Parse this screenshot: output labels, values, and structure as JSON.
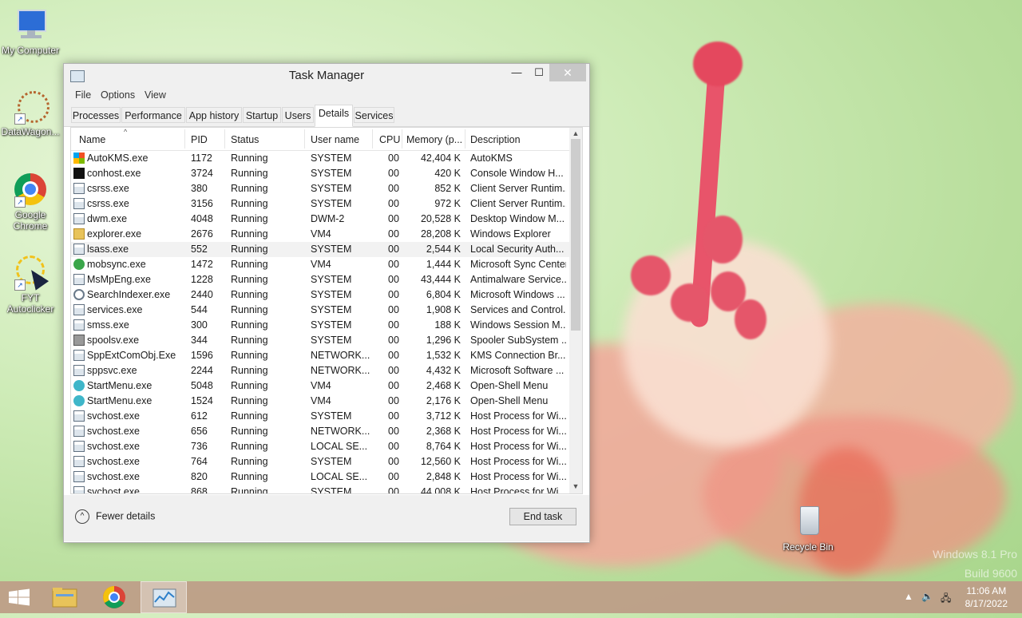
{
  "desktop": {
    "icons": [
      {
        "label": "My Computer"
      },
      {
        "label": "DataWagon..."
      },
      {
        "label": "Google Chrome"
      },
      {
        "label": "FYT Autoclicker"
      },
      {
        "label": "Recycle Bin"
      }
    ],
    "watermark_line1": "Windows 8.1 Pro",
    "watermark_line2": "Build 9600"
  },
  "window": {
    "title": "Task Manager",
    "minimize": "—",
    "maximize": "☐",
    "close": "✕",
    "menu": [
      "File",
      "Options",
      "View"
    ],
    "tabs": [
      "Processes",
      "Performance",
      "App history",
      "Startup",
      "Users",
      "Details",
      "Services"
    ],
    "active_tab": "Details",
    "columns": [
      "Name",
      "PID",
      "Status",
      "User name",
      "CPU",
      "Memory (p...",
      "Description"
    ],
    "rows": [
      {
        "name": "AutoKMS.exe",
        "pid": "1172",
        "status": "Running",
        "user": "SYSTEM",
        "cpu": "00",
        "mem": "42,404 K",
        "desc": "AutoKMS",
        "icon": "ms-logo-icon"
      },
      {
        "name": "conhost.exe",
        "pid": "3724",
        "status": "Running",
        "user": "SYSTEM",
        "cpu": "00",
        "mem": "420 K",
        "desc": "Console Window H...",
        "icon": "console-icon"
      },
      {
        "name": "csrss.exe",
        "pid": "380",
        "status": "Running",
        "user": "SYSTEM",
        "cpu": "00",
        "mem": "852 K",
        "desc": "Client Server Runtim...",
        "icon": "app-icon"
      },
      {
        "name": "csrss.exe",
        "pid": "3156",
        "status": "Running",
        "user": "SYSTEM",
        "cpu": "00",
        "mem": "972 K",
        "desc": "Client Server Runtim...",
        "icon": "app-icon"
      },
      {
        "name": "dwm.exe",
        "pid": "4048",
        "status": "Running",
        "user": "DWM-2",
        "cpu": "00",
        "mem": "20,528 K",
        "desc": "Desktop Window M...",
        "icon": "app-icon"
      },
      {
        "name": "explorer.exe",
        "pid": "2676",
        "status": "Running",
        "user": "VM4",
        "cpu": "00",
        "mem": "28,208 K",
        "desc": "Windows Explorer",
        "icon": "folder-icon"
      },
      {
        "name": "lsass.exe",
        "pid": "552",
        "status": "Running",
        "user": "SYSTEM",
        "cpu": "00",
        "mem": "2,544 K",
        "desc": "Local Security Auth...",
        "icon": "app-icon"
      },
      {
        "name": "mobsync.exe",
        "pid": "1472",
        "status": "Running",
        "user": "VM4",
        "cpu": "00",
        "mem": "1,444 K",
        "desc": "Microsoft Sync Center",
        "icon": "sync-icon"
      },
      {
        "name": "MsMpEng.exe",
        "pid": "1228",
        "status": "Running",
        "user": "SYSTEM",
        "cpu": "00",
        "mem": "43,444 K",
        "desc": "Antimalware Service...",
        "icon": "app-icon"
      },
      {
        "name": "SearchIndexer.exe",
        "pid": "2440",
        "status": "Running",
        "user": "SYSTEM",
        "cpu": "00",
        "mem": "6,804 K",
        "desc": "Microsoft Windows ...",
        "icon": "search-icon"
      },
      {
        "name": "services.exe",
        "pid": "544",
        "status": "Running",
        "user": "SYSTEM",
        "cpu": "00",
        "mem": "1,908 K",
        "desc": "Services and Control...",
        "icon": "app-icon"
      },
      {
        "name": "smss.exe",
        "pid": "300",
        "status": "Running",
        "user": "SYSTEM",
        "cpu": "00",
        "mem": "188 K",
        "desc": "Windows Session M...",
        "icon": "app-icon"
      },
      {
        "name": "spoolsv.exe",
        "pid": "344",
        "status": "Running",
        "user": "SYSTEM",
        "cpu": "00",
        "mem": "1,296 K",
        "desc": "Spooler SubSystem ...",
        "icon": "printer-icon"
      },
      {
        "name": "SppExtComObj.Exe",
        "pid": "1596",
        "status": "Running",
        "user": "NETWORK...",
        "cpu": "00",
        "mem": "1,532 K",
        "desc": "KMS Connection Br...",
        "icon": "app-icon"
      },
      {
        "name": "sppsvc.exe",
        "pid": "2244",
        "status": "Running",
        "user": "NETWORK...",
        "cpu": "00",
        "mem": "4,432 K",
        "desc": "Microsoft Software ...",
        "icon": "app-icon"
      },
      {
        "name": "StartMenu.exe",
        "pid": "5048",
        "status": "Running",
        "user": "VM4",
        "cpu": "00",
        "mem": "2,468 K",
        "desc": "Open-Shell Menu",
        "icon": "shell-icon"
      },
      {
        "name": "StartMenu.exe",
        "pid": "1524",
        "status": "Running",
        "user": "VM4",
        "cpu": "00",
        "mem": "2,176 K",
        "desc": "Open-Shell Menu",
        "icon": "shell-icon"
      },
      {
        "name": "svchost.exe",
        "pid": "612",
        "status": "Running",
        "user": "SYSTEM",
        "cpu": "00",
        "mem": "3,712 K",
        "desc": "Host Process for Wi...",
        "icon": "app-icon"
      },
      {
        "name": "svchost.exe",
        "pid": "656",
        "status": "Running",
        "user": "NETWORK...",
        "cpu": "00",
        "mem": "2,368 K",
        "desc": "Host Process for Wi...",
        "icon": "app-icon"
      },
      {
        "name": "svchost.exe",
        "pid": "736",
        "status": "Running",
        "user": "LOCAL SE...",
        "cpu": "00",
        "mem": "8,764 K",
        "desc": "Host Process for Wi...",
        "icon": "app-icon"
      },
      {
        "name": "svchost.exe",
        "pid": "764",
        "status": "Running",
        "user": "SYSTEM",
        "cpu": "00",
        "mem": "12,560 K",
        "desc": "Host Process for Wi...",
        "icon": "app-icon"
      },
      {
        "name": "svchost.exe",
        "pid": "820",
        "status": "Running",
        "user": "LOCAL SE...",
        "cpu": "00",
        "mem": "2,848 K",
        "desc": "Host Process for Wi...",
        "icon": "app-icon"
      },
      {
        "name": "svchost.exe",
        "pid": "868",
        "status": "Running",
        "user": "SYSTEM",
        "cpu": "00",
        "mem": "44,008 K",
        "desc": "Host Process for Wi...",
        "icon": "app-icon"
      }
    ],
    "selected_row": "lsass.exe",
    "fewer_details": "Fewer details",
    "end_task": "End task"
  },
  "taskbar": {
    "time": "11:06 AM",
    "date": "8/17/2022",
    "items": [
      "start-icon",
      "file-explorer-icon",
      "chrome-icon",
      "task-manager-icon"
    ]
  }
}
